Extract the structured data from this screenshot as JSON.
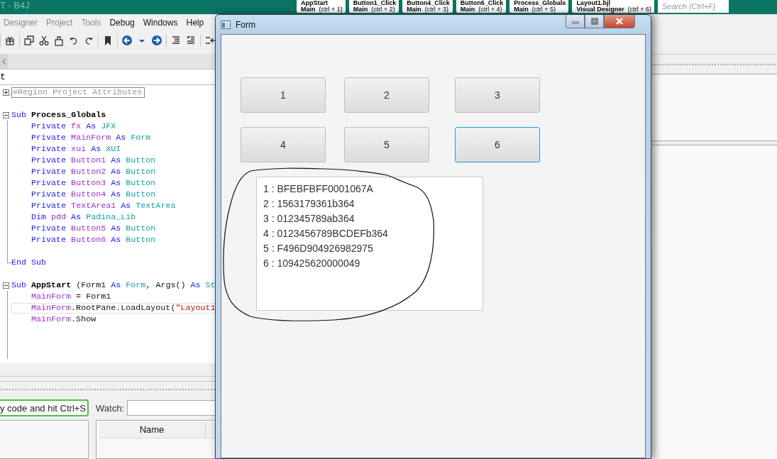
{
  "ide": {
    "title": "T - B4J",
    "doc_tabs": [
      {
        "name": "AppStart",
        "module": "Main",
        "shortcut": "(ctrl + 1)"
      },
      {
        "name": "Button1_Click",
        "module": "Main",
        "shortcut": "(ctrl + 2)"
      },
      {
        "name": "Button4_Click",
        "module": "Main",
        "shortcut": "(ctrl + 3)"
      },
      {
        "name": "Button6_Click",
        "module": "Main",
        "shortcut": "(ctrl + 4)"
      },
      {
        "name": "Process_Globals",
        "module": "Main",
        "shortcut": "(ctrl + 5)"
      },
      {
        "name": "Layout1.bjl",
        "module": "Visual Designer",
        "shortcut": "(ctrl + 6)"
      }
    ],
    "search": {
      "placeholder": "Search (Ctrl+F)"
    },
    "menu": [
      {
        "label": "Designer",
        "disabled": true
      },
      {
        "label": "Project",
        "disabled": true
      },
      {
        "label": "Tools",
        "disabled": true
      },
      {
        "label": "Debug",
        "disabled": false
      },
      {
        "label": "Windows",
        "disabled": false
      },
      {
        "label": "Help",
        "disabled": false
      }
    ],
    "module_tab": "t",
    "code_lines": [
      {
        "kind": "region",
        "tokens": [
          {
            "kind": "region",
            "text": "#Region Project Attributes"
          }
        ]
      },
      {
        "kind": "blank"
      },
      {
        "kind": "sub_start",
        "tokens": [
          {
            "kind": "keyword",
            "text": "Sub"
          },
          {
            "kind": "bold",
            "text": " Process_Globals"
          }
        ]
      },
      {
        "kind": "body",
        "tokens": [
          {
            "kind": "keyword",
            "text": "Private"
          },
          {
            "kind": "name",
            "text": " fx"
          },
          {
            "kind": "keyword",
            "text": " As"
          },
          {
            "kind": "type",
            "text": " JFX"
          }
        ]
      },
      {
        "kind": "body",
        "tokens": [
          {
            "kind": "keyword",
            "text": "Private"
          },
          {
            "kind": "name",
            "text": " MainForm"
          },
          {
            "kind": "keyword",
            "text": " As"
          },
          {
            "kind": "type",
            "text": " Form"
          }
        ]
      },
      {
        "kind": "body",
        "tokens": [
          {
            "kind": "keyword",
            "text": "Private"
          },
          {
            "kind": "name",
            "text": " xui"
          },
          {
            "kind": "keyword",
            "text": " As"
          },
          {
            "kind": "type",
            "text": " XUI"
          }
        ]
      },
      {
        "kind": "body",
        "tokens": [
          {
            "kind": "keyword",
            "text": "Private"
          },
          {
            "kind": "name",
            "text": " Button1"
          },
          {
            "kind": "keyword",
            "text": " As"
          },
          {
            "kind": "type",
            "text": " Button"
          }
        ]
      },
      {
        "kind": "body",
        "tokens": [
          {
            "kind": "keyword",
            "text": "Private"
          },
          {
            "kind": "name",
            "text": " Button2"
          },
          {
            "kind": "keyword",
            "text": " As"
          },
          {
            "kind": "type",
            "text": " Button"
          }
        ]
      },
      {
        "kind": "body",
        "tokens": [
          {
            "kind": "keyword",
            "text": "Private"
          },
          {
            "kind": "name",
            "text": " Button3"
          },
          {
            "kind": "keyword",
            "text": " As"
          },
          {
            "kind": "type",
            "text": " Button"
          }
        ]
      },
      {
        "kind": "body",
        "tokens": [
          {
            "kind": "keyword",
            "text": "Private"
          },
          {
            "kind": "name",
            "text": " Button4"
          },
          {
            "kind": "keyword",
            "text": " As"
          },
          {
            "kind": "type",
            "text": " Button"
          }
        ]
      },
      {
        "kind": "body",
        "tokens": [
          {
            "kind": "keyword",
            "text": "Private"
          },
          {
            "kind": "name",
            "text": " TextArea1"
          },
          {
            "kind": "keyword",
            "text": " As"
          },
          {
            "kind": "type",
            "text": " TextArea"
          }
        ]
      },
      {
        "kind": "body",
        "tokens": [
          {
            "kind": "keyword",
            "text": "Dim"
          },
          {
            "kind": "name",
            "text": " pdd"
          },
          {
            "kind": "keyword",
            "text": " As"
          },
          {
            "kind": "type",
            "text": " Padina_Lib"
          }
        ]
      },
      {
        "kind": "body",
        "tokens": [
          {
            "kind": "keyword",
            "text": "Private"
          },
          {
            "kind": "name",
            "text": " Button5"
          },
          {
            "kind": "keyword",
            "text": " As"
          },
          {
            "kind": "type",
            "text": " Button"
          }
        ]
      },
      {
        "kind": "body",
        "tokens": [
          {
            "kind": "keyword",
            "text": "Private"
          },
          {
            "kind": "name",
            "text": " Button6"
          },
          {
            "kind": "keyword",
            "text": " As"
          },
          {
            "kind": "type",
            "text": " Button"
          }
        ]
      },
      {
        "kind": "body"
      },
      {
        "kind": "sub_end",
        "tokens": [
          {
            "kind": "keyword",
            "text": "End Sub"
          }
        ]
      },
      {
        "kind": "blank"
      },
      {
        "kind": "sub_start",
        "tokens": [
          {
            "kind": "keyword",
            "text": "Sub"
          },
          {
            "kind": "bold",
            "text": " AppStart"
          },
          {
            "kind": "plain",
            "text": " (Form1 "
          },
          {
            "kind": "keyword",
            "text": "As"
          },
          {
            "kind": "type",
            "text": " Form"
          },
          {
            "kind": "plain",
            "text": ", Args() "
          },
          {
            "kind": "keyword",
            "text": "As"
          },
          {
            "kind": "type",
            "text": " St"
          }
        ]
      },
      {
        "kind": "body",
        "tokens": [
          {
            "kind": "name",
            "text": "MainForm"
          },
          {
            "kind": "plain",
            "text": " = Form1"
          }
        ]
      },
      {
        "kind": "body",
        "current": true,
        "tokens": [
          {
            "kind": "name",
            "text": "MainForm"
          },
          {
            "kind": "plain",
            "text": ".RootPane.LoadLayout("
          },
          {
            "kind": "string",
            "text": "\"Layout1"
          }
        ]
      },
      {
        "kind": "body",
        "tokens": [
          {
            "kind": "name",
            "text": "MainForm"
          },
          {
            "kind": "plain",
            "text": ".Show"
          }
        ]
      },
      {
        "kind": "body"
      },
      {
        "kind": "body"
      },
      {
        "kind": "body"
      }
    ],
    "hint_field": {
      "value": "y code and hit Ctrl+S"
    },
    "watch": {
      "label": "Watch:",
      "columns": [
        "Name"
      ]
    }
  },
  "form_window": {
    "title": "Form",
    "buttons": [
      {
        "label": "1",
        "focused": false
      },
      {
        "label": "2",
        "focused": false
      },
      {
        "label": "3",
        "focused": false
      },
      {
        "label": "4",
        "focused": false
      },
      {
        "label": "5",
        "focused": false
      },
      {
        "label": "6",
        "focused": true
      }
    ],
    "text_area": {
      "lines": [
        "1 : BFEBFBFF0001067A",
        "2 : 1563179361b364",
        "3 : 012345789ab364",
        "4 : 0123456789BCDEFb364",
        "5 : F496D904926982975",
        "6 : 109425620000049"
      ]
    }
  }
}
